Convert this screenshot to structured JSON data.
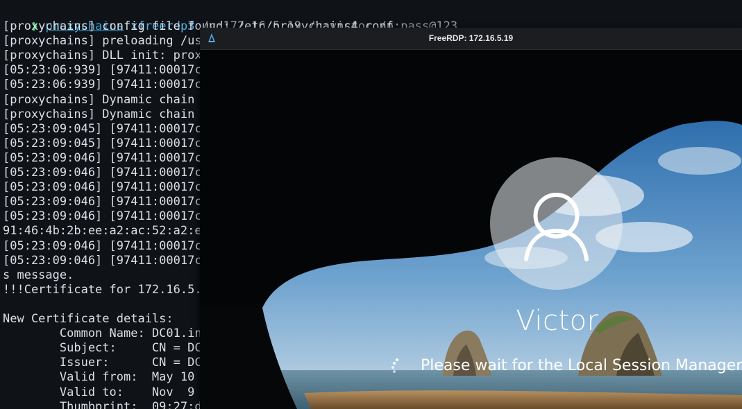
{
  "terminal": {
    "prompt_symbol": "❯",
    "command": {
      "proxychains": "proxychains",
      "binary": "xfreerdp3",
      "args": "/v:172.16.5.19 /u:victor /p:pass@123"
    },
    "lines": [
      "[proxychains] config file found: /etc/proxychains4.conf",
      "[proxychains] preloading /us",
      "[proxychains] DLL init: prox",
      "[05:23:06:939] [97411:00017c",
      "[05:23:06:939] [97411:00017c",
      "[proxychains] Dynamic chain",
      "[proxychains] Dynamic chain",
      "[05:23:09:045] [97411:00017c",
      "[05:23:09:045] [97411:00017c",
      "[05:23:09:046] [97411:00017c",
      "[05:23:09:046] [97411:00017c",
      "[05:23:09:046] [97411:00017c",
      "[05:23:09:046] [97411:00017c",
      "[05:23:09:046] [97411:00017c",
      "91:46:4b:2b:ee:a2:ac:52:a2:e",
      "[05:23:09:046] [97411:00017c",
      "[05:23:09:046] [97411:00017c",
      "s message.",
      "!!!Certificate for 172.16.5.",
      "",
      "New Certificate details:",
      "        Common Name: DC01.in",
      "        Subject:     CN = DC",
      "        Issuer:      CN = DC",
      "        Valid from:  May 10 ",
      "        Valid to:    Nov  9 ",
      "        Thumbprint:  09:27:d"
    ]
  },
  "rdp": {
    "window_title": "FreeRDP: 172.16.5.19",
    "app_icon": "freerdp-icon",
    "login_screen": {
      "avatar_icon": "user-icon",
      "username": "Victor",
      "spinner_icon": "loading-spinner-icon",
      "status": "Please wait for the Local Session Manager"
    }
  }
}
